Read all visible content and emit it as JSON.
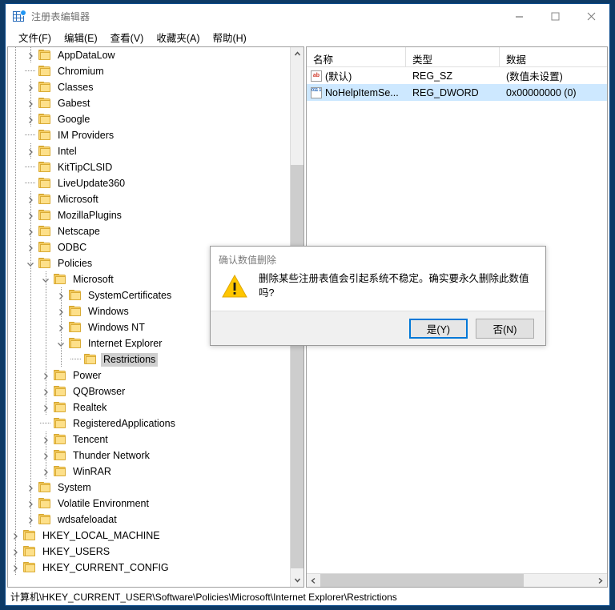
{
  "window": {
    "title": "注册表编辑器",
    "app_icon": "registry-editor-icon",
    "controls": {
      "minimize": "minimize-icon",
      "maximize": "maximize-icon",
      "close": "close-icon"
    }
  },
  "menu": {
    "items": [
      {
        "label": "文件(F)"
      },
      {
        "label": "编辑(E)"
      },
      {
        "label": "查看(V)"
      },
      {
        "label": "收藏夹(A)"
      },
      {
        "label": "帮助(H)"
      }
    ]
  },
  "tree": {
    "nodes": [
      {
        "label": "AppDataLow",
        "indent": 1,
        "state": "collapsed",
        "selected": false
      },
      {
        "label": "Chromium",
        "indent": 1,
        "state": "leaf",
        "selected": false
      },
      {
        "label": "Classes",
        "indent": 1,
        "state": "collapsed",
        "selected": false
      },
      {
        "label": "Gabest",
        "indent": 1,
        "state": "collapsed",
        "selected": false
      },
      {
        "label": "Google",
        "indent": 1,
        "state": "collapsed",
        "selected": false
      },
      {
        "label": "IM Providers",
        "indent": 1,
        "state": "leaf",
        "selected": false
      },
      {
        "label": "Intel",
        "indent": 1,
        "state": "collapsed",
        "selected": false
      },
      {
        "label": "KitTipCLSID",
        "indent": 1,
        "state": "leaf",
        "selected": false
      },
      {
        "label": "LiveUpdate360",
        "indent": 1,
        "state": "leaf",
        "selected": false
      },
      {
        "label": "Microsoft",
        "indent": 1,
        "state": "collapsed",
        "selected": false
      },
      {
        "label": "MozillaPlugins",
        "indent": 1,
        "state": "collapsed",
        "selected": false
      },
      {
        "label": "Netscape",
        "indent": 1,
        "state": "collapsed",
        "selected": false
      },
      {
        "label": "ODBC",
        "indent": 1,
        "state": "collapsed",
        "selected": false
      },
      {
        "label": "Policies",
        "indent": 1,
        "state": "expanded",
        "selected": false
      },
      {
        "label": "Microsoft",
        "indent": 2,
        "state": "expanded",
        "selected": false
      },
      {
        "label": "SystemCertificates",
        "indent": 3,
        "state": "collapsed",
        "selected": false
      },
      {
        "label": "Windows",
        "indent": 3,
        "state": "collapsed",
        "selected": false
      },
      {
        "label": "Windows NT",
        "indent": 3,
        "state": "collapsed",
        "selected": false
      },
      {
        "label": "Internet Explorer",
        "indent": 3,
        "state": "expanded",
        "selected": false
      },
      {
        "label": "Restrictions",
        "indent": 4,
        "state": "leaf",
        "selected": true
      },
      {
        "label": "Power",
        "indent": 2,
        "state": "collapsed",
        "selected": false
      },
      {
        "label": "QQBrowser",
        "indent": 2,
        "state": "collapsed",
        "selected": false
      },
      {
        "label": "Realtek",
        "indent": 2,
        "state": "collapsed",
        "selected": false
      },
      {
        "label": "RegisteredApplications",
        "indent": 2,
        "state": "leaf",
        "selected": false
      },
      {
        "label": "Tencent",
        "indent": 2,
        "state": "collapsed",
        "selected": false
      },
      {
        "label": "Thunder Network",
        "indent": 2,
        "state": "collapsed",
        "selected": false
      },
      {
        "label": "WinRAR",
        "indent": 2,
        "state": "collapsed",
        "selected": false
      },
      {
        "label": "System",
        "indent": 1,
        "state": "collapsed",
        "selected": false
      },
      {
        "label": "Volatile Environment",
        "indent": 1,
        "state": "collapsed",
        "selected": false
      },
      {
        "label": "wdsafeloadat",
        "indent": 1,
        "state": "collapsed",
        "selected": false
      },
      {
        "label": "HKEY_LOCAL_MACHINE",
        "indent": 0,
        "state": "collapsed",
        "selected": false
      },
      {
        "label": "HKEY_USERS",
        "indent": 0,
        "state": "collapsed",
        "selected": false
      },
      {
        "label": "HKEY_CURRENT_CONFIG",
        "indent": 0,
        "state": "collapsed",
        "selected": false
      }
    ]
  },
  "values": {
    "columns": [
      "名称",
      "类型",
      "数据"
    ],
    "rows": [
      {
        "icon": "string-value-icon",
        "icon_text": "ab",
        "name": "(默认)",
        "type": "REG_SZ",
        "data": "(数值未设置)",
        "selected": false
      },
      {
        "icon": "dword-value-icon",
        "icon_text": "011 110 010",
        "name": "NoHelpItemSe...",
        "type": "REG_DWORD",
        "data": "0x00000000 (0)",
        "selected": true
      }
    ]
  },
  "status": {
    "path": "计算机\\HKEY_CURRENT_USER\\Software\\Policies\\Microsoft\\Internet Explorer\\Restrictions"
  },
  "dialog": {
    "title": "确认数值删除",
    "icon": "warning-triangle-icon",
    "message": "删除某些注册表值会引起系统不稳定。确实要永久删除此数值吗?",
    "buttons": {
      "yes": "是(Y)",
      "no": "否(N)"
    }
  },
  "colors": {
    "accent": "#0078d7",
    "selection": "#cde8ff",
    "warning": "#ffc600",
    "folder": "#fcd670"
  }
}
